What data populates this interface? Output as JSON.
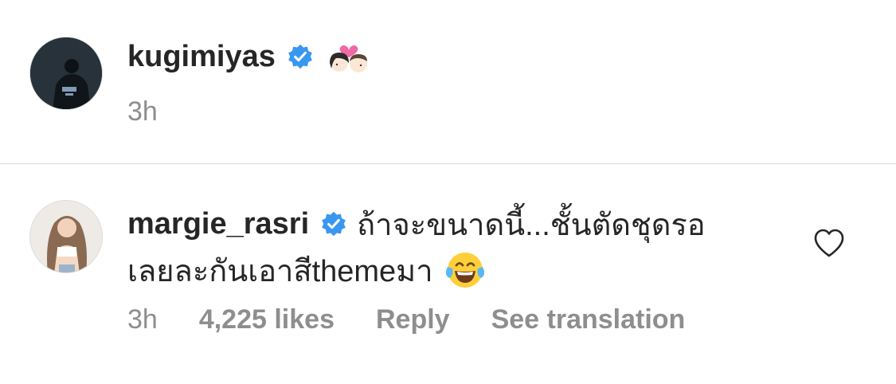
{
  "comments": [
    {
      "username": "kugimiyas",
      "verified": true,
      "text": "",
      "text_line2": "",
      "emoji": "couple-with-heart",
      "time": "3h",
      "avatar_icon": "profile-photo-person-icon"
    },
    {
      "username": "margie_rasri",
      "verified": true,
      "text": "ถ้าจะขนาดนี้...ชั้นตัดชุดรอ",
      "text_line2": "เลยละกันเอาสีthemeมา",
      "emoji": "face-with-tears-of-joy",
      "time": "3h",
      "likes": "4,225 likes",
      "reply_label": "Reply",
      "translate_label": "See translation",
      "avatar_icon": "profile-photo-person-icon",
      "like_icon": "heart-outline-icon"
    }
  ],
  "colors": {
    "verified_badge": "#3897f0",
    "text": "#262626",
    "meta": "#8e8e8e",
    "divider": "#dbdbdb"
  }
}
